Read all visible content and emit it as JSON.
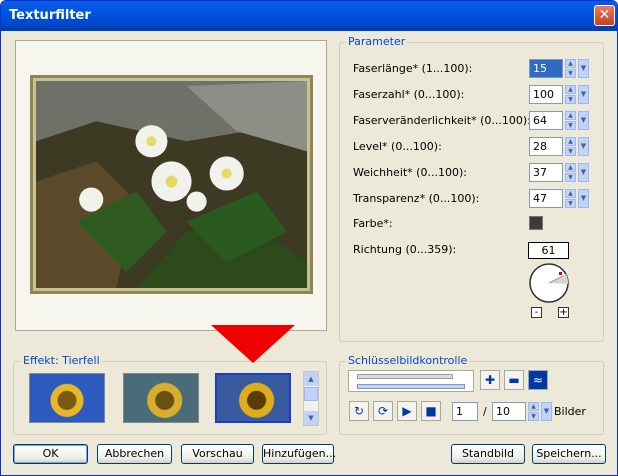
{
  "window": {
    "title": "Texturfilter",
    "close_glyph": "✕"
  },
  "parameters": {
    "group_label": "Parameter",
    "rows": [
      {
        "label": "Faserlänge* (1...100):",
        "value": "15"
      },
      {
        "label": "Faserzahl* (0...100):",
        "value": "100"
      },
      {
        "label": "Faserveränderlichkeit* (0...100):",
        "value": "64"
      },
      {
        "label": "Level* (0...100):",
        "value": "28"
      },
      {
        "label": "Weichheit* (0...100):",
        "value": "37"
      },
      {
        "label": "Transparenz* (0...100):",
        "value": "47"
      }
    ],
    "color_label": "Farbe*:",
    "color_value": "#3c3c3c",
    "direction_label": "Richtung (0...359):",
    "direction_value": "61",
    "minus_label": "-",
    "plus_label": "+"
  },
  "effect": {
    "group_label": "Effekt: Tierfell"
  },
  "keyframe": {
    "group_label": "Schlüsselbildkontrolle",
    "frame_value": "1",
    "separator": "/",
    "total_value": "10",
    "frames_label": "Bilder"
  },
  "buttons": {
    "ok": "OK",
    "cancel": "Abbrechen",
    "preview": "Vorschau",
    "add": "Hinzufügen...",
    "still": "Standbild",
    "save": "Speichern..."
  },
  "colors": {
    "titlebar": "#0054e3",
    "accent": "#0046d5",
    "red_arrow": "#f00000"
  },
  "icons": [
    "close-icon",
    "spin-up-icon",
    "spin-down-icon",
    "dropdown-icon",
    "add-keyframe-icon",
    "remove-keyframe-icon",
    "keyframe-mode-icon",
    "loop-icon",
    "reset-icon",
    "play-icon",
    "stop-icon"
  ]
}
